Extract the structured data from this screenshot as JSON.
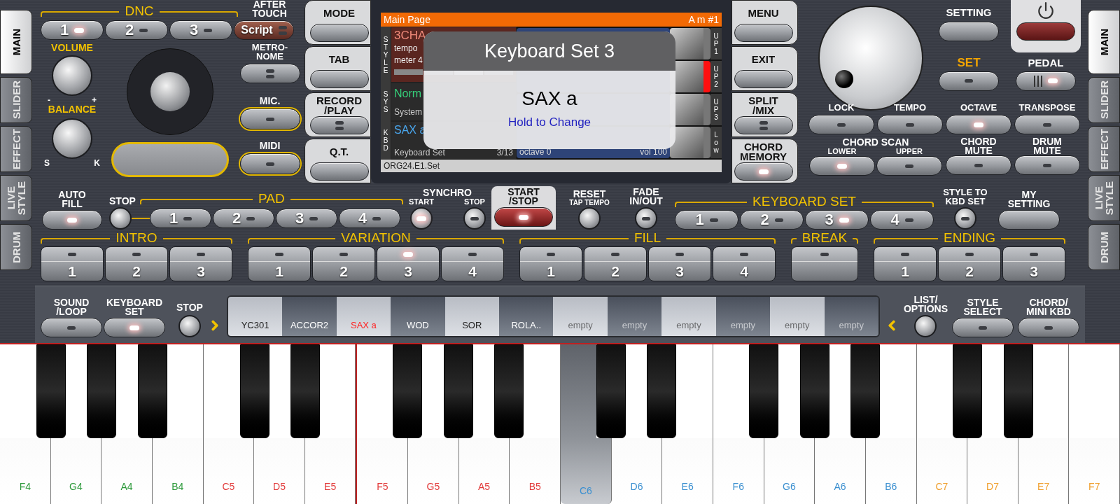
{
  "side_tabs_left": [
    {
      "label": "MAIN",
      "selected": true
    },
    {
      "label": "SLIDER",
      "selected": false
    },
    {
      "label": "EFFECT",
      "selected": false
    },
    {
      "label": "LIVE\nSTYLE",
      "selected": false
    },
    {
      "label": "DRUM",
      "selected": false
    }
  ],
  "dnc": {
    "title": "DNC",
    "after_touch": "AFTER\nTOUCH",
    "buttons": [
      {
        "label": "1",
        "kind": "number",
        "lit": true
      },
      {
        "label": "2",
        "kind": "number",
        "lit": false
      },
      {
        "label": "3",
        "kind": "number",
        "lit": false
      },
      {
        "label": "Script",
        "kind": "script",
        "lit": false
      }
    ]
  },
  "volume": {
    "label": "VOLUME",
    "minus": "-",
    "plus": "+"
  },
  "balance": {
    "label": "BALANCE",
    "left": "S",
    "right": "K"
  },
  "metronome": {
    "label": "METRO-\nNOME",
    "lit": false
  },
  "mic": {
    "label": "MIC.",
    "lit": false
  },
  "midi": {
    "label": "MIDI",
    "lit": false
  },
  "mode_column": [
    {
      "label": "MODE",
      "kind": "plain"
    },
    {
      "label": "TAB",
      "kind": "plain"
    },
    {
      "label": "RECORD\n/PLAY",
      "kind": "double",
      "lit": false
    },
    {
      "label": "Q.T.",
      "kind": "plain"
    }
  ],
  "screen": {
    "title": "Main Page",
    "chord": "A m #1",
    "section_labels": [
      "STYLE",
      "SYS",
      "KBD"
    ],
    "style_name": "3CHA",
    "style_lines": [
      "tempo",
      "meter 4"
    ],
    "sys_name": "Norm",
    "sys_line": "System",
    "kbd_name": "SAX a",
    "kbd_line": "Keyboard Set",
    "kbd_count": "3/13",
    "kbd_octave": "octave 0",
    "kbd_volume": "vol 100",
    "footer": "ORG24.E1.Set",
    "parts": [
      {
        "label": "UP1",
        "selected": false
      },
      {
        "label": "UP2",
        "selected": true
      },
      {
        "label": "UP3",
        "selected": false
      },
      {
        "label": "Low",
        "selected": false
      }
    ]
  },
  "popup": {
    "title": "Keyboard Set 3",
    "value": "SAX a",
    "hint": "Hold to Change"
  },
  "menu_column": [
    {
      "label": "MENU",
      "kind": "plain"
    },
    {
      "label": "EXIT",
      "kind": "plain"
    },
    {
      "label": "SPLIT\n/MIX",
      "kind": "double",
      "lit": false
    },
    {
      "label": "CHORD\nMEMORY",
      "kind": "single",
      "lit": true
    }
  ],
  "setting": {
    "label": "SETTING"
  },
  "set": {
    "label": "SET",
    "lit": false
  },
  "pedal": {
    "label": "PEDAL",
    "lit": true
  },
  "function_buttons": [
    {
      "label": "LOCK",
      "lit": false
    },
    {
      "label": "TEMPO",
      "lit": false
    },
    {
      "label": "OCTAVE",
      "lit": true
    },
    {
      "label": "TRANSPOSE",
      "lit": false
    }
  ],
  "chord_scan": {
    "title": "CHORD SCAN",
    "buttons": [
      {
        "label": "LOWER",
        "lit": true
      },
      {
        "label": "UPPER",
        "lit": false
      }
    ]
  },
  "mutes": [
    {
      "label": "CHORD\nMUTE",
      "lit": false
    },
    {
      "label": "DRUM\nMUTE",
      "lit": false
    }
  ],
  "auto_fill": {
    "label": "AUTO\nFILL",
    "lit": true
  },
  "pad": {
    "title": "PAD",
    "stop": "STOP",
    "buttons": [
      {
        "label": "1",
        "lit": false
      },
      {
        "label": "2",
        "lit": false
      },
      {
        "label": "3",
        "lit": false
      },
      {
        "label": "4",
        "lit": false
      }
    ]
  },
  "synchro": {
    "title": "SYNCHRO",
    "start": {
      "label": "START",
      "lit": true
    },
    "stop": {
      "label": "STOP",
      "lit": false
    }
  },
  "start_stop": {
    "label": "START\n/STOP",
    "lit": true
  },
  "reset": {
    "label": "RESET",
    "sublabel": "TAP TEMPO"
  },
  "fade": {
    "label": "FADE\nIN/OUT",
    "lit": false
  },
  "keyboard_set": {
    "title": "KEYBOARD SET",
    "buttons": [
      {
        "label": "1",
        "lit": false
      },
      {
        "label": "2",
        "lit": false
      },
      {
        "label": "3",
        "lit": true
      },
      {
        "label": "4",
        "lit": false
      }
    ]
  },
  "style_to_kbd": {
    "label": "STYLE TO\nKBD SET",
    "lit": false
  },
  "my_setting": {
    "label": "MY\nSETTING"
  },
  "sections": [
    {
      "title": "INTRO",
      "buttons": [
        {
          "label": "1",
          "lit": false
        },
        {
          "label": "2",
          "lit": false
        },
        {
          "label": "3",
          "lit": false
        }
      ]
    },
    {
      "title": "VARIATION",
      "buttons": [
        {
          "label": "1",
          "lit": false
        },
        {
          "label": "2",
          "lit": false
        },
        {
          "label": "3",
          "lit": true
        },
        {
          "label": "4",
          "lit": false
        }
      ]
    },
    {
      "title": "FILL",
      "buttons": [
        {
          "label": "1",
          "lit": false
        },
        {
          "label": "2",
          "lit": false
        },
        {
          "label": "3",
          "lit": false
        },
        {
          "label": "4",
          "lit": false
        }
      ]
    },
    {
      "title": "BREAK",
      "buttons": [
        {
          "lit": false
        }
      ]
    },
    {
      "title": "ENDING",
      "buttons": [
        {
          "label": "1",
          "lit": false
        },
        {
          "label": "2",
          "lit": false
        },
        {
          "label": "3",
          "lit": false
        }
      ]
    }
  ],
  "sound_loop": {
    "label": "SOUND\n/LOOP",
    "lit": false
  },
  "keyboard_set_button": {
    "label": "KEYBOARD\nSET",
    "lit": true
  },
  "sound_stop": {
    "label": "STOP"
  },
  "sounds": [
    {
      "name": "YC301",
      "selected": false,
      "empty": false
    },
    {
      "name": "ACCOR2",
      "selected": false,
      "empty": false
    },
    {
      "name": "SAX a",
      "selected": true,
      "empty": false
    },
    {
      "name": "WOD",
      "selected": false,
      "empty": false
    },
    {
      "name": "SOR",
      "selected": false,
      "empty": false
    },
    {
      "name": "ROLA..",
      "selected": false,
      "empty": false
    },
    {
      "name": "empty",
      "selected": false,
      "empty": true
    },
    {
      "name": "empty",
      "selected": false,
      "empty": true
    },
    {
      "name": "empty",
      "selected": false,
      "empty": true
    },
    {
      "name": "empty",
      "selected": false,
      "empty": true
    },
    {
      "name": "empty",
      "selected": false,
      "empty": true
    },
    {
      "name": "empty",
      "selected": false,
      "empty": true
    }
  ],
  "list_options": {
    "label": "LIST/\nOPTIONS"
  },
  "style_select": {
    "label": "STYLE\nSELECT",
    "lit": false
  },
  "chord_mini_kbd": {
    "label": "CHORD/\nMINI KBD",
    "lit": false
  },
  "side_tabs_right": [
    {
      "label": "MAIN",
      "selected": true
    },
    {
      "label": "SLIDER",
      "selected": false
    },
    {
      "label": "EFFECT",
      "selected": false
    },
    {
      "label": "LIVE\nSTYLE",
      "selected": false
    },
    {
      "label": "DRUM",
      "selected": false
    }
  ],
  "keys": [
    {
      "note": "F4",
      "color": "#2e9a3c",
      "pressed": false,
      "split": false
    },
    {
      "note": "G4",
      "color": "#2e9a3c",
      "pressed": false,
      "split": false
    },
    {
      "note": "A4",
      "color": "#2e9a3c",
      "pressed": false,
      "split": false
    },
    {
      "note": "B4",
      "color": "#2e9a3c",
      "pressed": false,
      "split": false
    },
    {
      "note": "C5",
      "color": "#e23a3a",
      "pressed": false,
      "split": false
    },
    {
      "note": "D5",
      "color": "#e23a3a",
      "pressed": false,
      "split": false
    },
    {
      "note": "E5",
      "color": "#e23a3a",
      "pressed": false,
      "split": false
    },
    {
      "note": "F5",
      "color": "#e23a3a",
      "pressed": false,
      "split": true
    },
    {
      "note": "G5",
      "color": "#e23a3a",
      "pressed": false,
      "split": false
    },
    {
      "note": "A5",
      "color": "#e23a3a",
      "pressed": false,
      "split": false
    },
    {
      "note": "B5",
      "color": "#e23a3a",
      "pressed": false,
      "split": false
    },
    {
      "note": "C6",
      "color": "#3a8fd0",
      "pressed": true,
      "split": false
    },
    {
      "note": "D6",
      "color": "#3a8fd0",
      "pressed": false,
      "split": false
    },
    {
      "note": "E6",
      "color": "#3a8fd0",
      "pressed": false,
      "split": false
    },
    {
      "note": "F6",
      "color": "#3a8fd0",
      "pressed": false,
      "split": false
    },
    {
      "note": "G6",
      "color": "#3a8fd0",
      "pressed": false,
      "split": false
    },
    {
      "note": "A6",
      "color": "#3a8fd0",
      "pressed": false,
      "split": false
    },
    {
      "note": "B6",
      "color": "#3a8fd0",
      "pressed": false,
      "split": false
    },
    {
      "note": "C7",
      "color": "#f0a030",
      "pressed": false,
      "split": false
    },
    {
      "note": "D7",
      "color": "#f0a030",
      "pressed": false,
      "split": false
    },
    {
      "note": "E7",
      "color": "#f0a030",
      "pressed": false,
      "split": false
    },
    {
      "note": "F7",
      "color": "#f0a030",
      "pressed": false,
      "split": false
    }
  ]
}
